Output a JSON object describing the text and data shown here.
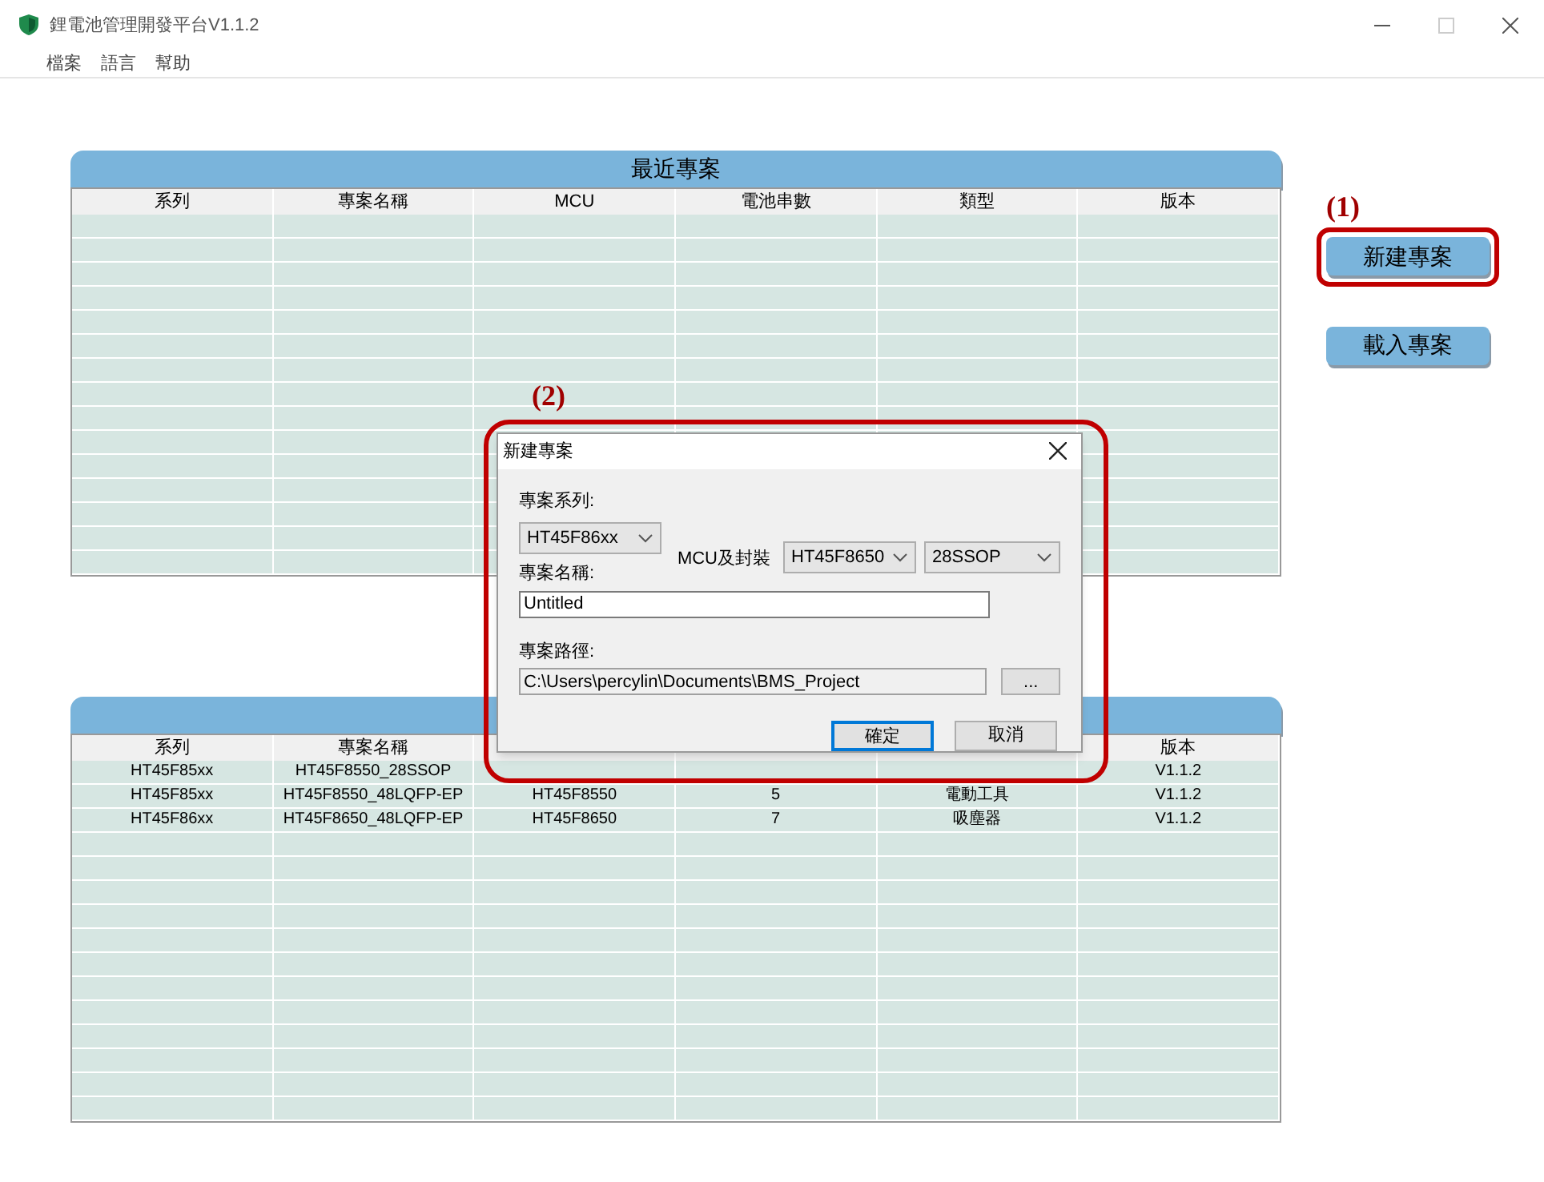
{
  "window": {
    "title": "鋰電池管理開發平台V1.1.2",
    "menu": [
      "檔案",
      "語言",
      "幫助"
    ]
  },
  "recent_table": {
    "title": "最近專案",
    "columns": [
      "系列",
      "專案名稱",
      "MCU",
      "電池串數",
      "類型",
      "版本"
    ]
  },
  "table_2": {
    "columns": [
      "系列",
      "專案名稱",
      null,
      null,
      null,
      "版本"
    ],
    "rows": [
      [
        "HT45F85xx",
        "HT45F8550_28SSOP",
        null,
        null,
        null,
        "V1.1.2"
      ],
      [
        "HT45F85xx",
        "HT45F8550_48LQFP-EP",
        "HT45F8550",
        "5",
        "電動工具",
        "V1.1.2"
      ],
      [
        "HT45F86xx",
        "HT45F8650_48LQFP-EP",
        "HT45F8650",
        "7",
        "吸塵器",
        "V1.1.2"
      ]
    ]
  },
  "side_buttons": [
    {
      "label": "新建專案",
      "highlighted": true,
      "annotation": "(1)"
    },
    {
      "label": "載入專案",
      "highlighted": false
    }
  ],
  "dialog": {
    "title": "新建專案",
    "annotation": "(2)",
    "series_label": "專案系列:",
    "series_value": "HT45F86xx",
    "mcu_label": "MCU及封裝",
    "mcu_value": "HT45F8650",
    "package_value": "28SSOP",
    "name_label": "專案名稱:",
    "name_value": "Untitled",
    "path_label": "專案路徑:",
    "path_value": "C:\\Users\\percylin\\Documents\\BMS_Project",
    "browse_button": "...",
    "buttons": [
      {
        "label": "確定",
        "default": true
      },
      {
        "label": "取消",
        "default": false
      }
    ]
  }
}
